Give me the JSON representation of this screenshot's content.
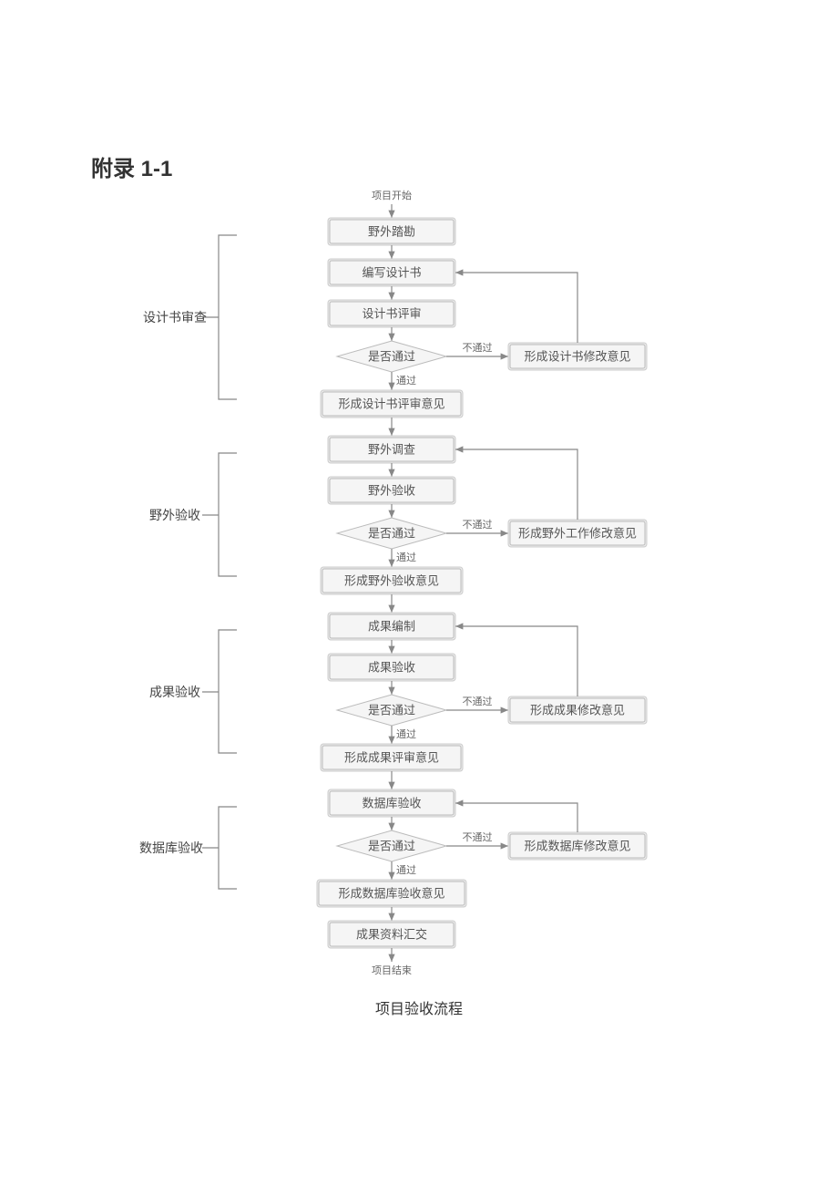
{
  "heading": "附录 1-1",
  "caption": "项目验收流程",
  "start": "项目开始",
  "end": "项目结束",
  "pass": "通过",
  "fail": "不通过",
  "decision": "是否通过",
  "stages": {
    "s1": {
      "label": "设计书审查",
      "b1": "野外踏勘",
      "b2": "编写设计书",
      "b3": "设计书评审",
      "out": "形成设计书评审意见",
      "rev": "形成设计书修改意见"
    },
    "s2": {
      "label": "野外验收",
      "b1": "野外调查",
      "b2": "野外验收",
      "out": "形成野外验收意见",
      "rev": "形成野外工作修改意见"
    },
    "s3": {
      "label": "成果验收",
      "b1": "成果编制",
      "b2": "成果验收",
      "out": "形成成果评审意见",
      "rev": "形成成果修改意见"
    },
    "s4": {
      "label": "数据库验收",
      "b1": "数据库验收",
      "out": "形成数据库验收意见",
      "rev": "形成数据库修改意见"
    },
    "final": "成果资料汇交"
  }
}
